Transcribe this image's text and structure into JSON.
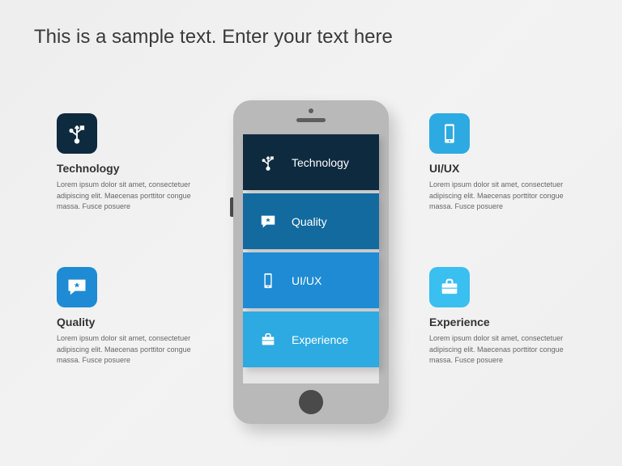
{
  "heading": "This is a sample text. Enter your text here",
  "features": {
    "technology": {
      "title": "Technology",
      "desc": "Lorem ipsum dolor sit amet, consectetuer adipiscing elit. Maecenas porttitor congue massa. Fusce posuere",
      "icon": "usb-icon",
      "color": "dark"
    },
    "quality": {
      "title": "Quality",
      "desc": "Lorem ipsum dolor sit amet, consectetuer adipiscing elit. Maecenas porttitor congue massa. Fusce posuere",
      "icon": "chat-star-icon",
      "color": "blue1"
    },
    "uiux": {
      "title": "UI/UX",
      "desc": "Lorem ipsum dolor sit amet, consectetuer adipiscing elit. Maecenas porttitor congue massa. Fusce posuere",
      "icon": "phone-icon",
      "color": "blue2"
    },
    "experience": {
      "title": "Experience",
      "desc": "Lorem ipsum dolor sit amet, consectetuer adipiscing elit. Maecenas porttitor congue massa. Fusce posuere",
      "icon": "briefcase-icon",
      "color": "blue3"
    }
  },
  "phone_menu": [
    {
      "label": "Technology",
      "icon": "usb-icon",
      "cls": "mi-dark"
    },
    {
      "label": "Quality",
      "icon": "chat-star-icon",
      "cls": "mi-b1"
    },
    {
      "label": "UI/UX",
      "icon": "phone-icon",
      "cls": "mi-b2"
    },
    {
      "label": "Experience",
      "icon": "briefcase-icon",
      "cls": "mi-b3"
    }
  ]
}
